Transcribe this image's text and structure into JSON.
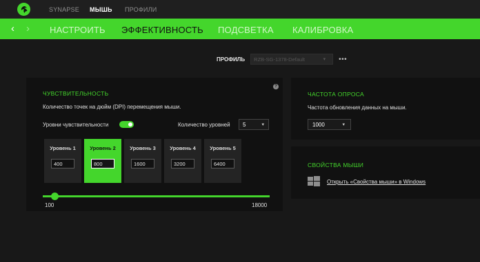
{
  "app": {
    "logo_icon": "razer-logo-icon",
    "top_tabs": [
      {
        "label": "SYNAPSE",
        "active": false
      },
      {
        "label": "МЫШЬ",
        "active": true
      },
      {
        "label": "ПРОФИЛИ",
        "active": false
      }
    ]
  },
  "subnav": {
    "back_icon": "chevron-left-icon",
    "forward_icon": "chevron-right-icon",
    "tabs": [
      {
        "label": "НАСТРОИТЬ",
        "active": false
      },
      {
        "label": "ЭФФЕКТИВНОСТЬ",
        "active": true
      },
      {
        "label": "ПОДСВЕТКА",
        "active": false
      },
      {
        "label": "КАЛИБРОВКА",
        "active": false
      }
    ]
  },
  "profile": {
    "label": "ПРОФИЛЬ",
    "value": "RZB-SG-1378-Default",
    "more": "•••"
  },
  "sensitivity": {
    "title": "ЧУВСТВИТЕЛЬНОСТЬ",
    "description": "Количество точек на дюйм (DPI) перемещения мыши.",
    "help_icon": "question-icon",
    "stages_label": "Уровни чувствительности",
    "stages_enabled": true,
    "stage_count_label": "Количество уровней",
    "stage_count_value": "5",
    "levels": [
      {
        "label": "Уровень 1",
        "value": "400",
        "active": false
      },
      {
        "label": "Уровень 2",
        "value": "800",
        "active": true
      },
      {
        "label": "Уровень 3",
        "value": "1600",
        "active": false
      },
      {
        "label": "Уровень 4",
        "value": "3200",
        "active": false
      },
      {
        "label": "Уровень 5",
        "value": "6400",
        "active": false
      }
    ],
    "slider_min": "100",
    "slider_max": "18000",
    "slider_value": 800
  },
  "polling": {
    "title": "ЧАСТОТА ОПРОСА",
    "description": "Частота обновления данных на мыши.",
    "value": "1000"
  },
  "mouse_props": {
    "title": "СВОЙСТВА МЫШИ",
    "icon": "windows-icon",
    "link": "Открыть «Свойства мыши» в Windows"
  },
  "colors": {
    "accent": "#44d62c",
    "background": "#181818",
    "panel": "#111111"
  }
}
